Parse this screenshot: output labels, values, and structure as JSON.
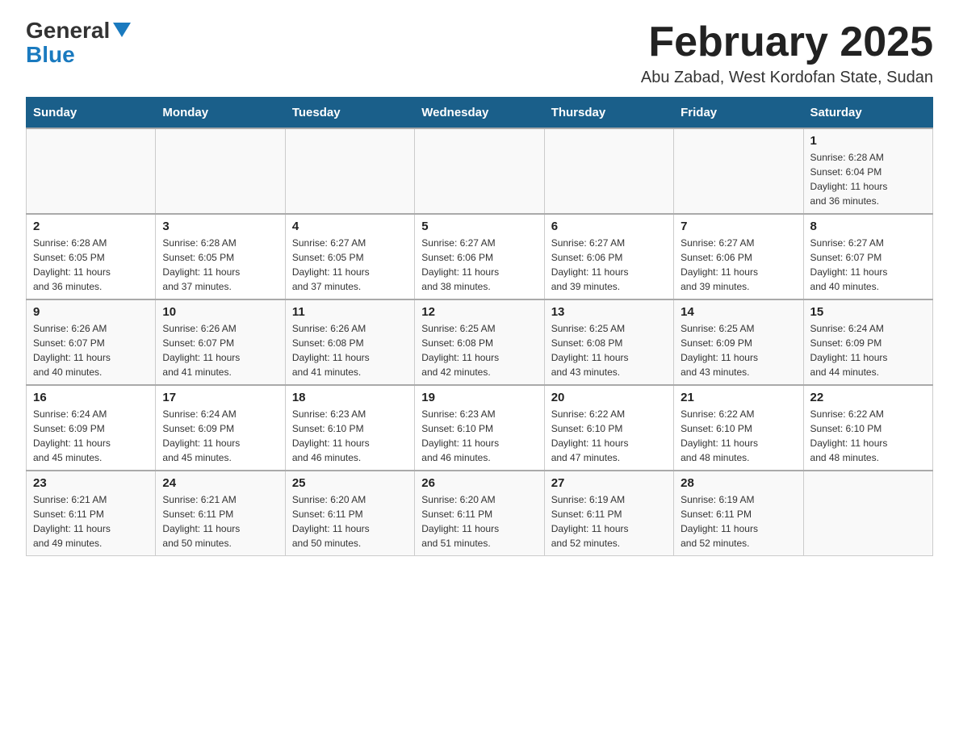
{
  "logo": {
    "general": "General",
    "blue": "Blue"
  },
  "header": {
    "month_year": "February 2025",
    "location": "Abu Zabad, West Kordofan State, Sudan"
  },
  "days_of_week": [
    "Sunday",
    "Monday",
    "Tuesday",
    "Wednesday",
    "Thursday",
    "Friday",
    "Saturday"
  ],
  "weeks": [
    [
      {
        "day": "",
        "info": ""
      },
      {
        "day": "",
        "info": ""
      },
      {
        "day": "",
        "info": ""
      },
      {
        "day": "",
        "info": ""
      },
      {
        "day": "",
        "info": ""
      },
      {
        "day": "",
        "info": ""
      },
      {
        "day": "1",
        "info": "Sunrise: 6:28 AM\nSunset: 6:04 PM\nDaylight: 11 hours\nand 36 minutes."
      }
    ],
    [
      {
        "day": "2",
        "info": "Sunrise: 6:28 AM\nSunset: 6:05 PM\nDaylight: 11 hours\nand 36 minutes."
      },
      {
        "day": "3",
        "info": "Sunrise: 6:28 AM\nSunset: 6:05 PM\nDaylight: 11 hours\nand 37 minutes."
      },
      {
        "day": "4",
        "info": "Sunrise: 6:27 AM\nSunset: 6:05 PM\nDaylight: 11 hours\nand 37 minutes."
      },
      {
        "day": "5",
        "info": "Sunrise: 6:27 AM\nSunset: 6:06 PM\nDaylight: 11 hours\nand 38 minutes."
      },
      {
        "day": "6",
        "info": "Sunrise: 6:27 AM\nSunset: 6:06 PM\nDaylight: 11 hours\nand 39 minutes."
      },
      {
        "day": "7",
        "info": "Sunrise: 6:27 AM\nSunset: 6:06 PM\nDaylight: 11 hours\nand 39 minutes."
      },
      {
        "day": "8",
        "info": "Sunrise: 6:27 AM\nSunset: 6:07 PM\nDaylight: 11 hours\nand 40 minutes."
      }
    ],
    [
      {
        "day": "9",
        "info": "Sunrise: 6:26 AM\nSunset: 6:07 PM\nDaylight: 11 hours\nand 40 minutes."
      },
      {
        "day": "10",
        "info": "Sunrise: 6:26 AM\nSunset: 6:07 PM\nDaylight: 11 hours\nand 41 minutes."
      },
      {
        "day": "11",
        "info": "Sunrise: 6:26 AM\nSunset: 6:08 PM\nDaylight: 11 hours\nand 41 minutes."
      },
      {
        "day": "12",
        "info": "Sunrise: 6:25 AM\nSunset: 6:08 PM\nDaylight: 11 hours\nand 42 minutes."
      },
      {
        "day": "13",
        "info": "Sunrise: 6:25 AM\nSunset: 6:08 PM\nDaylight: 11 hours\nand 43 minutes."
      },
      {
        "day": "14",
        "info": "Sunrise: 6:25 AM\nSunset: 6:09 PM\nDaylight: 11 hours\nand 43 minutes."
      },
      {
        "day": "15",
        "info": "Sunrise: 6:24 AM\nSunset: 6:09 PM\nDaylight: 11 hours\nand 44 minutes."
      }
    ],
    [
      {
        "day": "16",
        "info": "Sunrise: 6:24 AM\nSunset: 6:09 PM\nDaylight: 11 hours\nand 45 minutes."
      },
      {
        "day": "17",
        "info": "Sunrise: 6:24 AM\nSunset: 6:09 PM\nDaylight: 11 hours\nand 45 minutes."
      },
      {
        "day": "18",
        "info": "Sunrise: 6:23 AM\nSunset: 6:10 PM\nDaylight: 11 hours\nand 46 minutes."
      },
      {
        "day": "19",
        "info": "Sunrise: 6:23 AM\nSunset: 6:10 PM\nDaylight: 11 hours\nand 46 minutes."
      },
      {
        "day": "20",
        "info": "Sunrise: 6:22 AM\nSunset: 6:10 PM\nDaylight: 11 hours\nand 47 minutes."
      },
      {
        "day": "21",
        "info": "Sunrise: 6:22 AM\nSunset: 6:10 PM\nDaylight: 11 hours\nand 48 minutes."
      },
      {
        "day": "22",
        "info": "Sunrise: 6:22 AM\nSunset: 6:10 PM\nDaylight: 11 hours\nand 48 minutes."
      }
    ],
    [
      {
        "day": "23",
        "info": "Sunrise: 6:21 AM\nSunset: 6:11 PM\nDaylight: 11 hours\nand 49 minutes."
      },
      {
        "day": "24",
        "info": "Sunrise: 6:21 AM\nSunset: 6:11 PM\nDaylight: 11 hours\nand 50 minutes."
      },
      {
        "day": "25",
        "info": "Sunrise: 6:20 AM\nSunset: 6:11 PM\nDaylight: 11 hours\nand 50 minutes."
      },
      {
        "day": "26",
        "info": "Sunrise: 6:20 AM\nSunset: 6:11 PM\nDaylight: 11 hours\nand 51 minutes."
      },
      {
        "day": "27",
        "info": "Sunrise: 6:19 AM\nSunset: 6:11 PM\nDaylight: 11 hours\nand 52 minutes."
      },
      {
        "day": "28",
        "info": "Sunrise: 6:19 AM\nSunset: 6:11 PM\nDaylight: 11 hours\nand 52 minutes."
      },
      {
        "day": "",
        "info": ""
      }
    ]
  ]
}
